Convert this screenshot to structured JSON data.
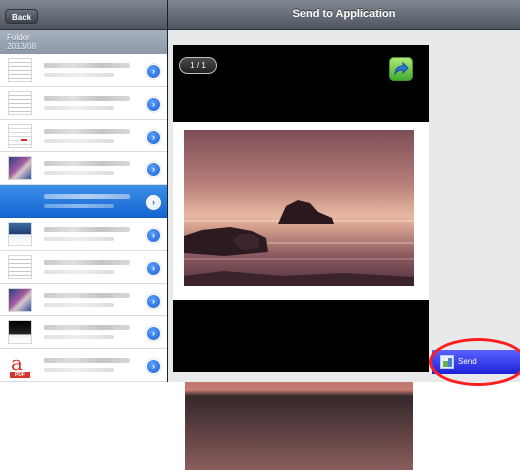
{
  "nav": {
    "back_label": "Back",
    "title": "Send to Application"
  },
  "folder": {
    "label": "Folder",
    "name": "2013/08"
  },
  "files": [
    {
      "thumb": "doc",
      "selected": false
    },
    {
      "thumb": "doc",
      "selected": false
    },
    {
      "thumb": "red-doc",
      "selected": false
    },
    {
      "thumb": "poster",
      "selected": false
    },
    {
      "thumb": "photo",
      "selected": true
    },
    {
      "thumb": "ocean",
      "selected": false
    },
    {
      "thumb": "doc",
      "selected": false
    },
    {
      "thumb": "poster",
      "selected": false
    },
    {
      "thumb": "dark",
      "selected": false
    },
    {
      "thumb": "pdf",
      "selected": false
    }
  ],
  "pdf_label": "PDF",
  "viewer": {
    "page_indicator": "1 / 1"
  },
  "send_button": {
    "label": "Send"
  },
  "icons": {
    "chevron": "chevron-right-icon",
    "share": "share-arrow-icon",
    "send": "application-icon"
  },
  "colors": {
    "selection": "#1f6fdd",
    "send_button": "#2429e0",
    "highlight": "#ff1d1d"
  }
}
